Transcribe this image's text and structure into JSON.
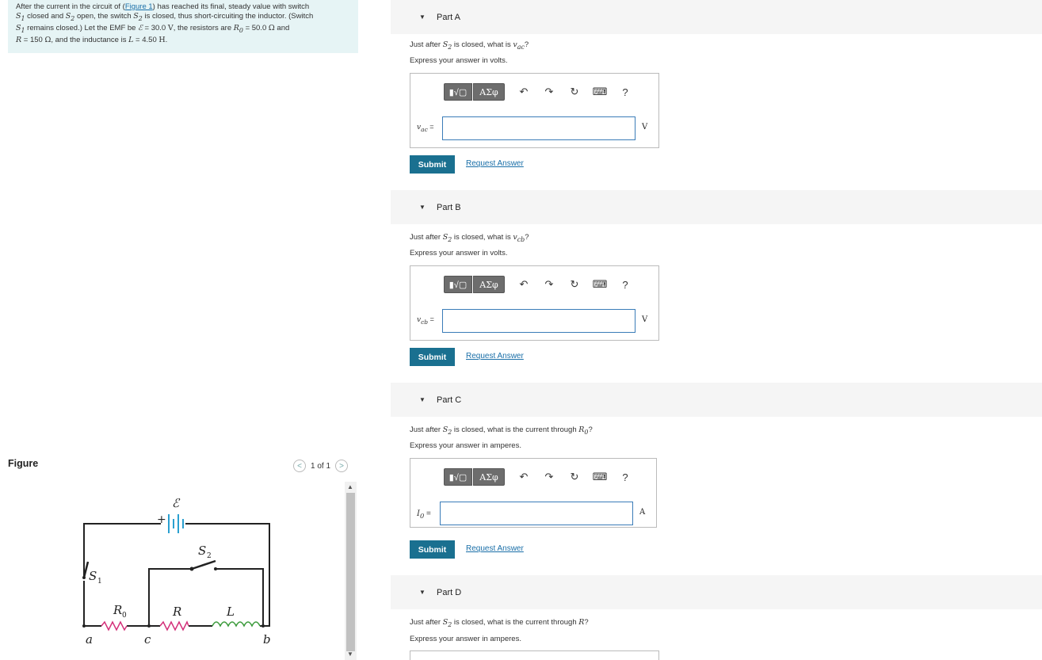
{
  "problem": {
    "l1_a": "After the current in the circuit of (",
    "l1_link": "Figure 1",
    "l1_b": ") has reached its final, steady value with switch",
    "l2_s1": "S",
    "l2_s1_sub": "1",
    "l2_a": " closed and ",
    "l2_s2": "S",
    "l2_s2_sub": "2",
    "l2_b": " open, the switch ",
    "l2_s2b": "S",
    "l2_s2b_sub": "2",
    "l2_c": " is closed, thus short-circuiting the inductor. (Switch",
    "l3_s1": "S",
    "l3_s1_sub": "1",
    "l3_a": " remains closed.) Let the EMF be ",
    "l3_emf": "ℰ",
    "l3_b": " = 30.0 ",
    "l3_v": "V",
    "l3_c": ", the resistors are ",
    "l3_r0": "R",
    "l3_r0_sub": "0",
    "l3_d": " = 50.0 ",
    "l3_ohm": "Ω",
    "l3_e": " and",
    "l4_r": "R",
    "l4_a": " = 150 ",
    "l4_ohm": "Ω",
    "l4_b": ", and the inductance is ",
    "l4_l": "L",
    "l4_c": " = 4.50 ",
    "l4_h": "H",
    "l4_d": "."
  },
  "figure": {
    "label": "Figure",
    "pager": "1 of 1",
    "prev": "<",
    "next": ">",
    "labels": {
      "emf": "ℰ",
      "plus": "+",
      "s1": "S",
      "s1_sub": "1",
      "s2": "S",
      "s2_sub": "2",
      "r0": "R",
      "r0_sub": "0",
      "r": "R",
      "l": "L",
      "a": "a",
      "c": "c",
      "b": "b"
    }
  },
  "toolbar": {
    "templates": "▮√▢",
    "greek": "ΑΣφ",
    "undo": "↶",
    "redo": "↷",
    "reset": "↻",
    "keyboard": "⌨",
    "help": "?"
  },
  "submit_label": "Submit",
  "request_label": "Request Answer",
  "parts": [
    {
      "title": "Part A",
      "q_pre": "Just after ",
      "q_var": "S",
      "q_var_sub": "2",
      "q_mid": " is closed, what is ",
      "q_target": "v",
      "q_target_sub": "ac",
      "q_post": "?",
      "express": "Express your answer in volts.",
      "ans_var": "v",
      "ans_sub": "ac",
      "ans_eq": " =",
      "unit": "V"
    },
    {
      "title": "Part B",
      "q_pre": "Just after ",
      "q_var": "S",
      "q_var_sub": "2",
      "q_mid": " is closed, what is ",
      "q_target": "v",
      "q_target_sub": "cb",
      "q_post": "?",
      "express": "Express your answer in volts.",
      "ans_var": "v",
      "ans_sub": "cb",
      "ans_eq": " =",
      "unit": "V"
    },
    {
      "title": "Part C",
      "q_pre": "Just after ",
      "q_var": "S",
      "q_var_sub": "2",
      "q_mid": " is closed, what is the current through ",
      "q_target": "R",
      "q_target_sub": "0",
      "q_post": "?",
      "express": "Express your answer in amperes.",
      "ans_var": "I",
      "ans_sub": "0",
      "ans_eq": " =",
      "unit": "A"
    },
    {
      "title": "Part D",
      "q_pre": "Just after ",
      "q_var": "S",
      "q_var_sub": "2",
      "q_mid": " is closed, what is the current through ",
      "q_target": "R",
      "q_target_sub": "",
      "q_post": "?",
      "express": "Express your answer in amperes."
    }
  ]
}
